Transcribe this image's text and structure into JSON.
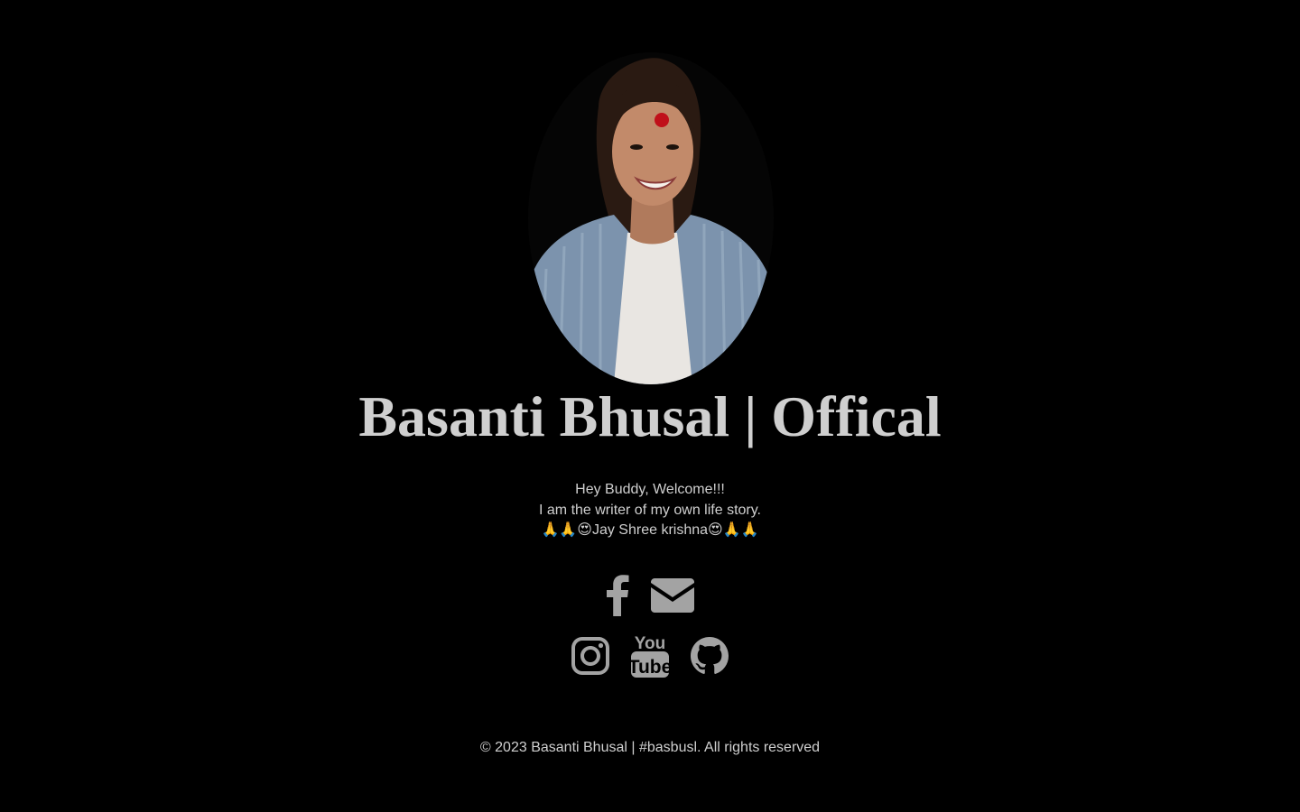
{
  "profile": {
    "title": "Basanti Bhusal | Offical",
    "bio_lines": [
      "Hey Buddy, Welcome!!!",
      "I am the writer of my own life story.",
      "🙏🙏😍Jay Shree krishna😍🙏🙏"
    ]
  },
  "social": {
    "row1": [
      {
        "name": "facebook",
        "icon": "facebook-icon"
      },
      {
        "name": "email",
        "icon": "envelope-icon"
      }
    ],
    "row2": [
      {
        "name": "instagram",
        "icon": "instagram-icon"
      },
      {
        "name": "youtube",
        "icon": "youtube-icon"
      },
      {
        "name": "github",
        "icon": "github-icon"
      }
    ]
  },
  "footer": {
    "text": "© 2023 Basanti Bhusal | #basbusl. All rights reserved"
  },
  "colors": {
    "background": "#000000",
    "text": "#cfcfcf",
    "icon": "#a3a3a3"
  }
}
